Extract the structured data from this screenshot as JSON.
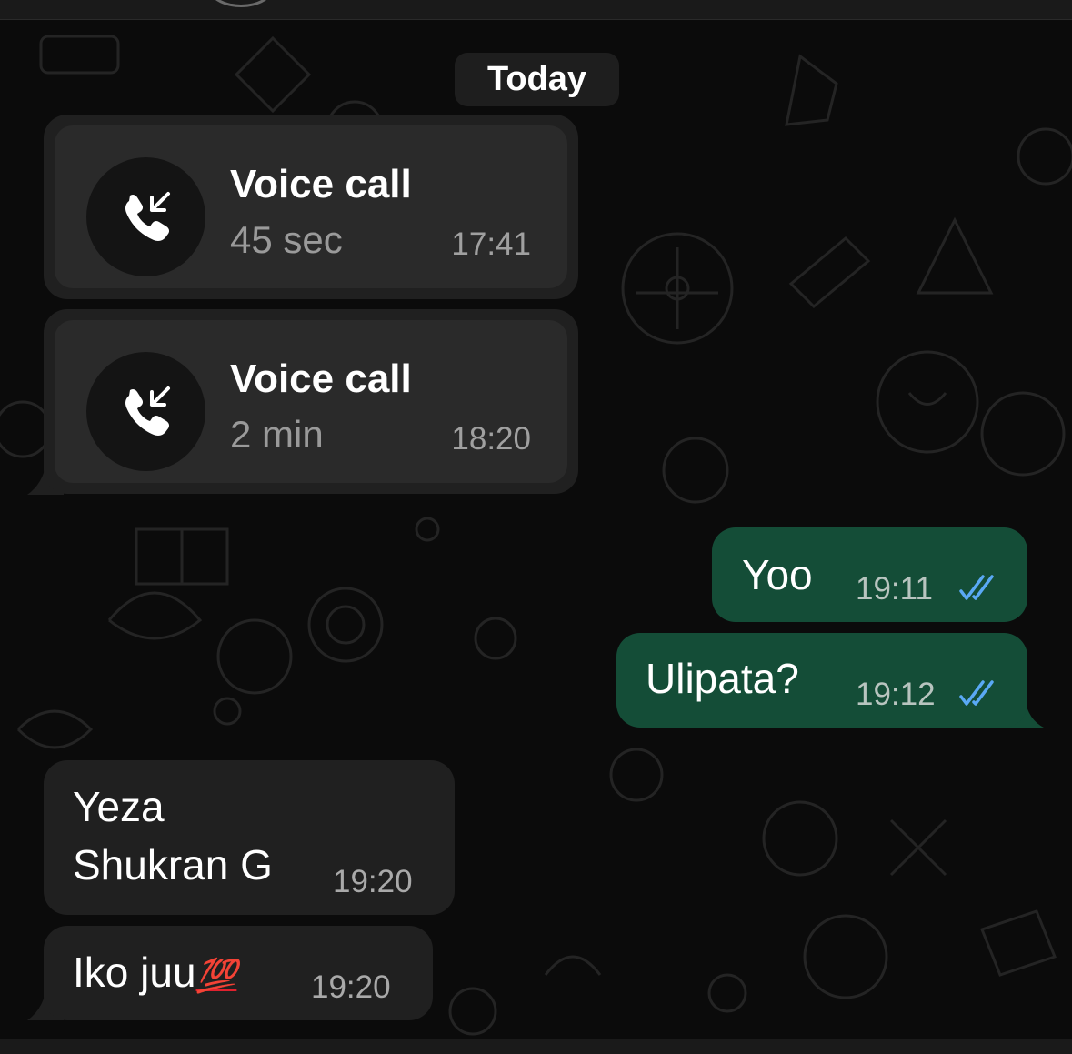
{
  "date_separator": "Today",
  "calls": [
    {
      "title": "Voice call",
      "duration": "45 sec",
      "time": "17:41",
      "icon": "incoming-call-icon"
    },
    {
      "title": "Voice call",
      "duration": "2 min",
      "time": "18:20",
      "icon": "incoming-call-icon"
    }
  ],
  "outgoing": [
    {
      "text": "Yoo",
      "time": "19:11",
      "status": "read"
    },
    {
      "text": "Ulipata?",
      "time": "19:12",
      "status": "read"
    }
  ],
  "incoming": [
    {
      "line1": "Yeza",
      "line2": "Shukran G",
      "time": "19:20"
    },
    {
      "text": "Iko juu",
      "emoji": "💯",
      "time": "19:20"
    }
  ],
  "colors": {
    "background": "#0b0b0b",
    "incoming_bubble": "#202020",
    "outgoing_bubble": "#144d37",
    "read_ticks": "#5aa9f5"
  }
}
